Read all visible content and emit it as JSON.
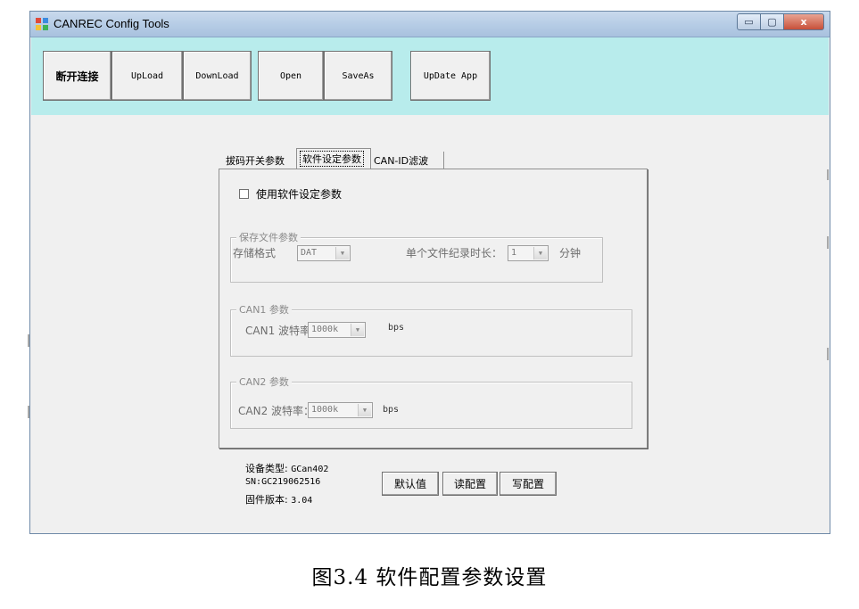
{
  "window": {
    "title": "CANREC Config Tools",
    "controls": {
      "minimize": "▭",
      "maximize": "▢",
      "close": "x"
    }
  },
  "toolbar": {
    "disconnect": "断开连接",
    "upload": "UpLoad",
    "download": "DownLoad",
    "open": "Open",
    "saveas": "SaveAs",
    "update_app": "UpDate App"
  },
  "tabs": {
    "dip_switch": "拔码开关参数",
    "software": "软件设定参数",
    "canid_filter": "CAN-ID滤波"
  },
  "software_panel": {
    "use_software_label": "使用软件设定参数",
    "use_software_checked": false,
    "save_file": {
      "group_title": "保存文件参数",
      "format_label": "存储格式",
      "format_value": "DAT",
      "duration_label": "单个文件纪录时长：",
      "duration_value": "1",
      "duration_unit": "分钟"
    },
    "can1": {
      "group_title": "CAN1 参数",
      "baud_label": "CAN1 波特率：",
      "baud_value": "1000k",
      "unit": "bps"
    },
    "can2": {
      "group_title": "CAN2 参数",
      "baud_label": "CAN2 波特率：",
      "baud_value": "1000k",
      "unit": "bps"
    }
  },
  "device_info": {
    "type_label": "设备类型:",
    "type_value": "GCan402",
    "sn_label": "SN:",
    "sn_value": "GC219062516",
    "fw_label": "固件版本:",
    "fw_value": "3.04"
  },
  "actions": {
    "default": "默认值",
    "read": "读配置",
    "write": "写配置"
  },
  "caption": "图3.4    软件配置参数设置",
  "colors": {
    "toolbar_bg": "#b8ecec",
    "window_bg": "#f0f0f0",
    "titlebar": "#b7cde6",
    "close_button": "#c7503a"
  }
}
